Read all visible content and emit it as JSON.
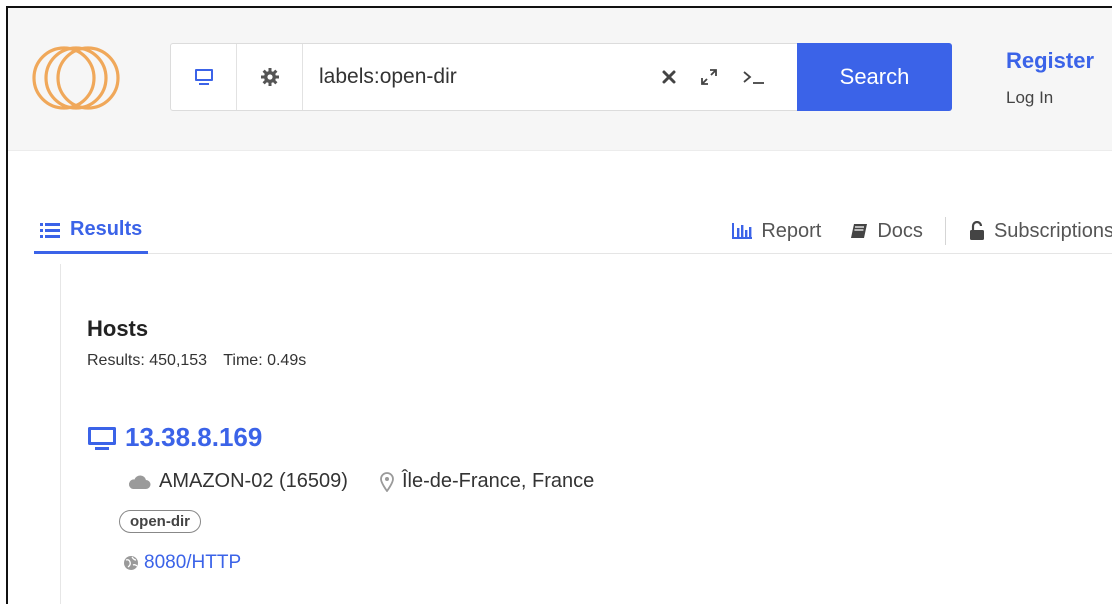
{
  "header": {
    "logo_icon": "interlocking-rings-logo",
    "monitor_icon": "monitor-icon",
    "settings_icon": "gear-icon",
    "search": {
      "value": "labels:open-dir"
    },
    "tools": [
      "clear-icon",
      "expand-icon",
      "terminal-icon"
    ],
    "search_button_label": "Search",
    "register_label": "Register",
    "login_label": "Log In"
  },
  "tabs": {
    "results_label": "Results",
    "report_label": "Report",
    "docs_label": "Docs",
    "subscriptions_label": "Subscriptions"
  },
  "results": {
    "title": "Hosts",
    "count_text": "Results: 450,153",
    "time_text": "Time: 0.49s",
    "hosts": [
      {
        "ip": "13.38.8.169",
        "asn": "AMAZON-02 (16509)",
        "location": "Île-de-France, France",
        "tag": "open-dir",
        "service": "8080/HTTP"
      }
    ]
  },
  "colors": {
    "accent": "#3b63e8",
    "logo": "#f0a85a",
    "header_bg": "#f6f6f6",
    "muted_icon": "#9a9a9a"
  }
}
